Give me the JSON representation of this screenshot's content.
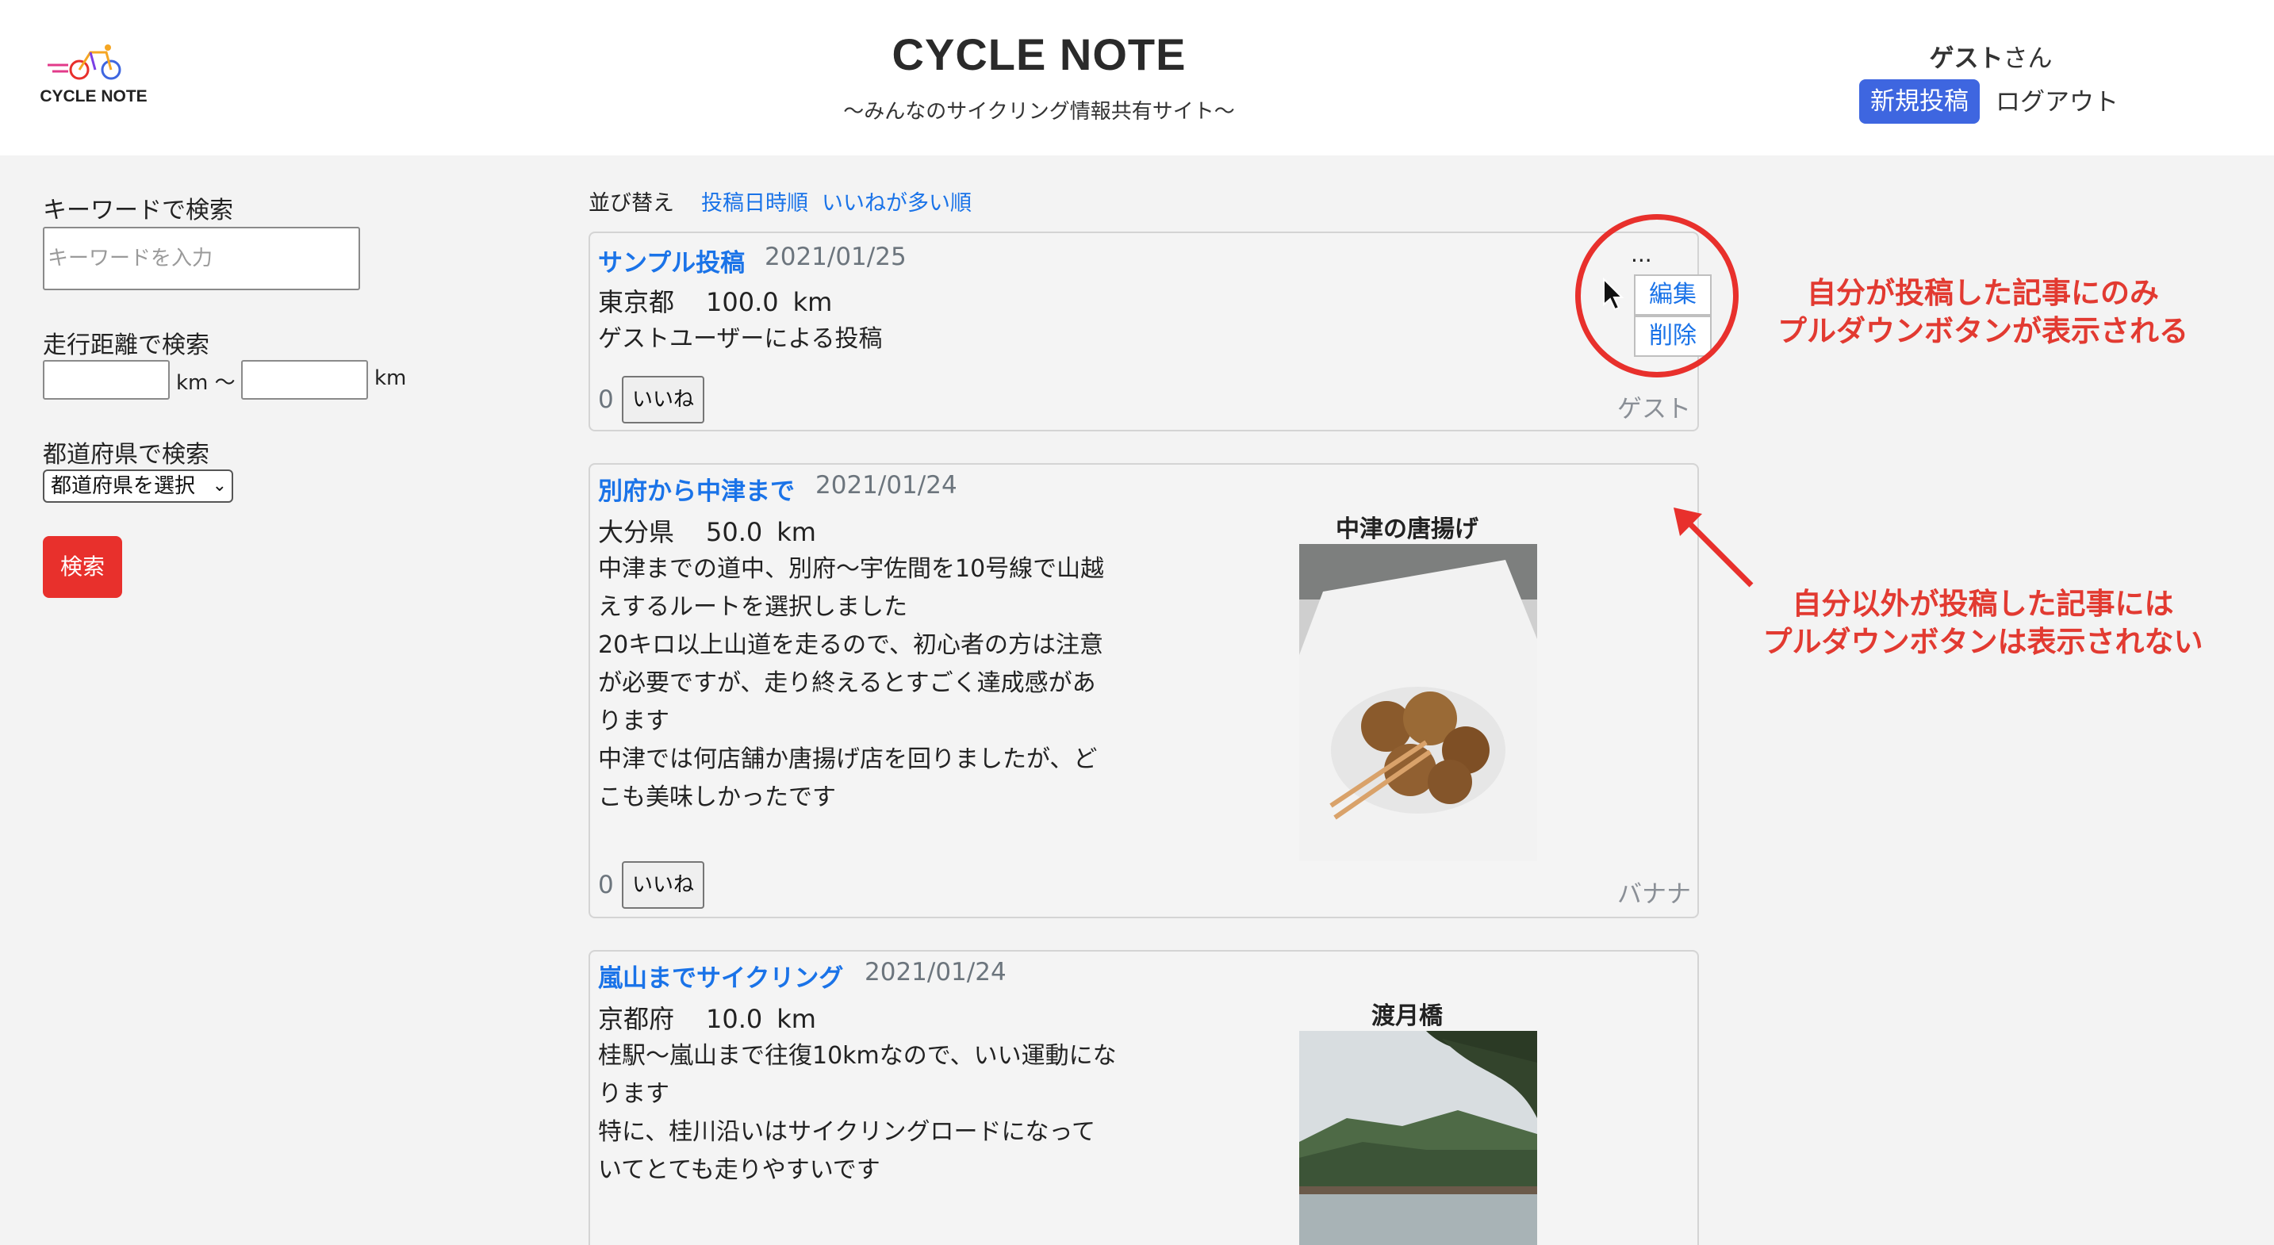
{
  "header": {
    "logo_text": "CYCLE NOTE",
    "title": "CYCLE NOTE",
    "subtitle": "〜みんなのサイクリング情報共有サイト〜",
    "user_name": "ゲスト",
    "user_suffix": "さん",
    "new_post_label": "新規投稿",
    "logout_label": "ログアウト"
  },
  "sidebar": {
    "keyword_label": "キーワードで検索",
    "keyword_placeholder": "キーワードを入力",
    "keyword_value": "",
    "distance_label": "走行距離で検索",
    "distance_min": "",
    "distance_max": "",
    "km_unit_1": "km 〜",
    "km_unit_2": "km",
    "prefecture_label": "都道府県で検索",
    "prefecture_selected": "都道府県を選択",
    "search_button": "検索"
  },
  "sort": {
    "label": "並び替え",
    "options": [
      "投稿日時順",
      "いいねが多い順"
    ]
  },
  "posts": [
    {
      "title": "サンプル投稿",
      "date": "2021/01/25",
      "prefecture": "東京都",
      "distance": "100.0",
      "unit": "km",
      "body": "ゲストユーザーによる投稿",
      "likes": "0",
      "like_label": "いいね",
      "author": "ゲスト",
      "menu_trigger": "...",
      "menu_items": [
        "編集",
        "削除"
      ]
    },
    {
      "title": "別府から中津まで",
      "date": "2021/01/24",
      "prefecture": "大分県",
      "distance": "50.0",
      "unit": "km",
      "body": "中津までの道中、別府〜宇佐間を10号線で山越\nえするルートを選択しました\n20キロ以上山道を走るので、初心者の方は注意\nが必要ですが、走り終えるとすごく達成感があ\nります\n中津では何店舗か唐揚げ店を回りましたが、ど\nこも美味しかったです",
      "image_caption": "中津の唐揚げ",
      "likes": "0",
      "like_label": "いいね",
      "author": "バナナ"
    },
    {
      "title": "嵐山までサイクリング",
      "date": "2021/01/24",
      "prefecture": "京都府",
      "distance": "10.0",
      "unit": "km",
      "body": "桂駅〜嵐山まで往復10kmなので、いい運動にな\nります\n特に、桂川沿いはサイクリングロードになって\nいてとても走りやすいです",
      "image_caption": "渡月橋"
    }
  ],
  "annotations": {
    "own_post_note": [
      "自分が投稿した記事にのみ",
      "プルダウンボタンが表示される"
    ],
    "other_post_note": [
      "自分以外が投稿した記事には",
      "プルダウンボタンは表示されない"
    ]
  },
  "colors": {
    "link": "#1a73e8",
    "primary": "#3e66e0",
    "danger": "#e8302c",
    "annotation": "#e23a31"
  }
}
